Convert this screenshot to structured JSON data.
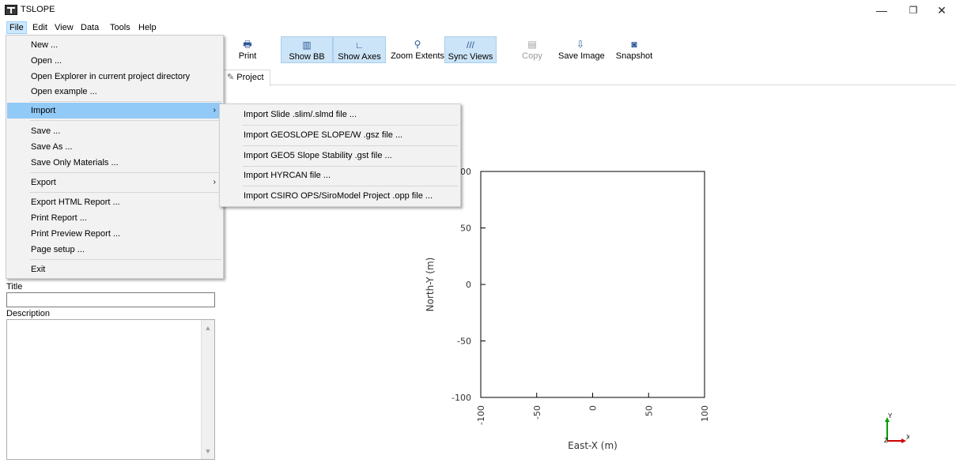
{
  "window": {
    "title": "TSLOPE",
    "minimize": "—",
    "maximize": "❐",
    "close": "✕"
  },
  "menubar": {
    "items": [
      "File",
      "Edit",
      "View",
      "Data",
      "Tools",
      "Help"
    ]
  },
  "toolbar": {
    "buttons": [
      {
        "label": "Print",
        "icon": "printer-icon",
        "glyph": "🖶",
        "pressed": false
      },
      {
        "label": "Show BB",
        "icon": "bounding-box-icon",
        "glyph": "▥",
        "pressed": true
      },
      {
        "label": "Show Axes",
        "icon": "axes-icon",
        "glyph": "∟",
        "pressed": true
      },
      {
        "label": "Zoom Extents",
        "icon": "magnifier-icon",
        "glyph": "⚲",
        "pressed": false
      },
      {
        "label": "Sync Views",
        "icon": "sync-views-icon",
        "glyph": "///",
        "pressed": true
      },
      {
        "label": "Copy",
        "icon": "copy-icon",
        "glyph": "▤",
        "pressed": false,
        "disabled": true
      },
      {
        "label": "Save Image",
        "icon": "save-image-icon",
        "glyph": "⇩",
        "pressed": false
      },
      {
        "label": "Snapshot",
        "icon": "camera-icon",
        "glyph": "◙",
        "pressed": false
      }
    ]
  },
  "tabs": {
    "project": "Project"
  },
  "left_panel": {
    "title_label": "Title",
    "title_value": "",
    "description_label": "Description",
    "description_value": ""
  },
  "file_menu": {
    "items": {
      "new": "New ...",
      "open": "Open ...",
      "open_explorer": "Open Explorer in current project directory",
      "open_example": "Open example ...",
      "import": "Import",
      "save": "Save ...",
      "save_as": "Save As ...",
      "save_only_materials": "Save Only Materials ...",
      "export": "Export",
      "export_html": "Export HTML Report ...",
      "print_report": "Print Report ...",
      "print_preview": "Print Preview Report ...",
      "page_setup": "Page setup ...",
      "exit": "Exit"
    },
    "submenu_arrow": "›"
  },
  "import_menu": {
    "items": [
      "Import Slide .slim/.slmd file ...",
      "Import GEOSLOPE SLOPE/W .gsz file ...",
      "Import GEO5 Slope Stability .gst file ...",
      "Import HYRCAN file ...",
      "Import CSIRO OPS/SiroModel Project .opp file ..."
    ]
  },
  "chart_data": {
    "type": "scatter",
    "xlabel": "East-X (m)",
    "ylabel": "North-Y (m)",
    "xlim": [
      -100,
      100
    ],
    "ylim": [
      -100,
      100
    ],
    "xticks": [
      "-100",
      "-50",
      "0",
      "50",
      "100"
    ],
    "yticks": [
      "-100",
      "-50",
      "0",
      "50",
      "100"
    ],
    "series": [],
    "grid": false
  },
  "axis_triad": {
    "y": "Y",
    "x": "X",
    "z": "Z",
    "y_color": "#00a000",
    "x_color": "#d00000"
  },
  "colors": {
    "menu_highlight": "#91c9f7",
    "pressed_button": "#cce4f7"
  }
}
